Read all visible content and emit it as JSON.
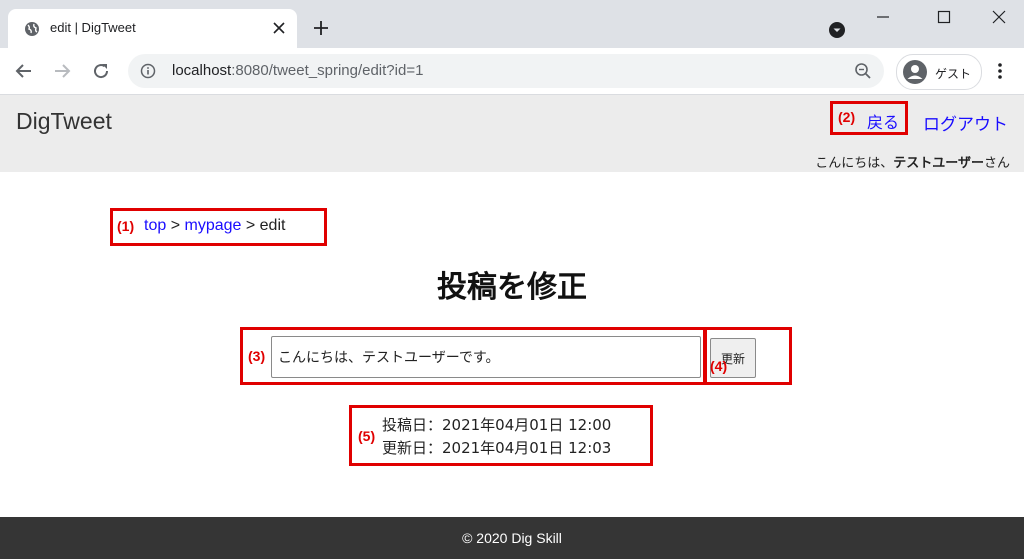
{
  "browser": {
    "tab_title": "edit | DigTweet",
    "url_host": "localhost",
    "url_rest": ":8080/tweet_spring/edit?id=1",
    "guest_label": "ゲスト",
    "accent": "#1a73e8"
  },
  "header": {
    "brand": "DigTweet",
    "back_label": "戻る",
    "logout_label": "ログアウト",
    "greeting_prefix": "こんにちは、",
    "user_name": "テストユーザー",
    "greeting_suffix": "さん"
  },
  "annotations": {
    "a1": "(1)",
    "a2": "(2)",
    "a3": "(3)",
    "a4": "(4)",
    "a5": "(5)",
    "color": "#e00000"
  },
  "breadcrumb": {
    "top": "top",
    "sep1": " > ",
    "mypage": "mypage",
    "sep2": " > ",
    "current": "edit"
  },
  "main": {
    "title": "投稿を修正",
    "tweet_value": "こんにちは、テストユーザーです。",
    "update_label": "更新",
    "posted_at": "投稿日：2021年04月01日 12:00",
    "updated_at": "更新日：2021年04月01日 12:03"
  },
  "footer": {
    "copyright": "© 2020 Dig Skill"
  },
  "colors": {
    "link": "#1a0dff",
    "header_bg": "#ececec",
    "footer_bg": "#353535"
  }
}
